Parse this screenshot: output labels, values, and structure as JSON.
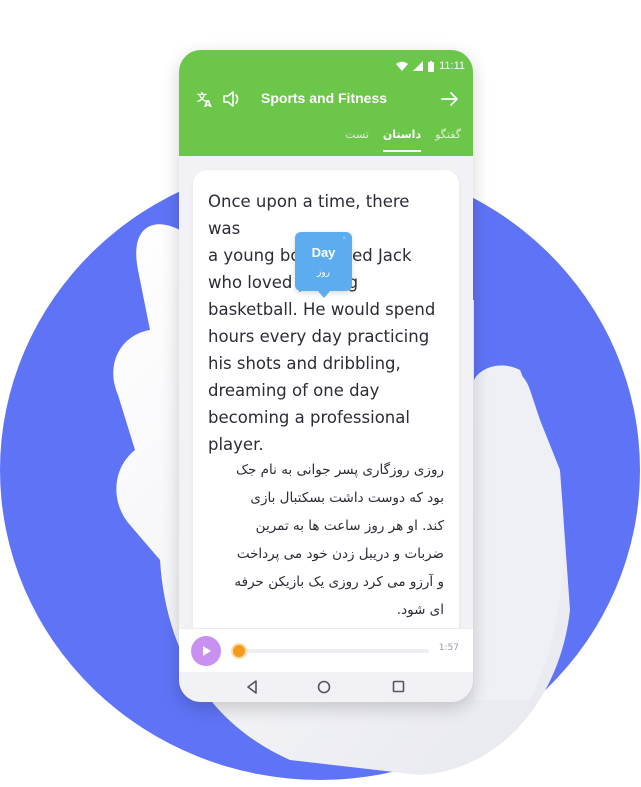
{
  "status_bar": {
    "time": "11:11",
    "icons": [
      "wifi-icon",
      "signal-icon",
      "battery-icon"
    ]
  },
  "app_bar": {
    "title": "Sports and Fitness",
    "left_icons": [
      "translate-icon",
      "speaker-icon"
    ],
    "right_icon": "arrow-right-icon"
  },
  "tabs": [
    {
      "label": "گفتگو",
      "active": false
    },
    {
      "label": "داستان",
      "active": true
    },
    {
      "label": "تست",
      "active": false
    }
  ],
  "story": {
    "english_lines": [
      "Once upon a time, there was",
      "a young boy named Jack",
      "who loved playing",
      "basketball. He would spend",
      "hours every day practicing",
      "his shots and dribbling,",
      "dreaming of one day",
      "becoming a professional",
      "player."
    ],
    "persian_lines": [
      "روزی روزگاری پسر جوانی به نام جک",
      "بود که دوست داشت بسکتبال بازی",
      "کند. او هر روز ساعت ها به تمرین",
      "ضربات و دریبل زدن خود می پرداخت",
      "و آرزو می کرد روزی یک بازیکن حرفه",
      "ای شود."
    ]
  },
  "tooltip": {
    "word": "Day",
    "translation": "روز"
  },
  "player": {
    "time": "1:57",
    "progress": 0.02
  },
  "nav": {
    "icons": [
      "back-icon",
      "home-icon",
      "recents-icon"
    ]
  },
  "colors": {
    "accent": "#6cc64a",
    "background_circle": "#5f73f6",
    "tooltip": "#5cacf0",
    "play": "#c890f0",
    "knob": "#f59a1c"
  }
}
